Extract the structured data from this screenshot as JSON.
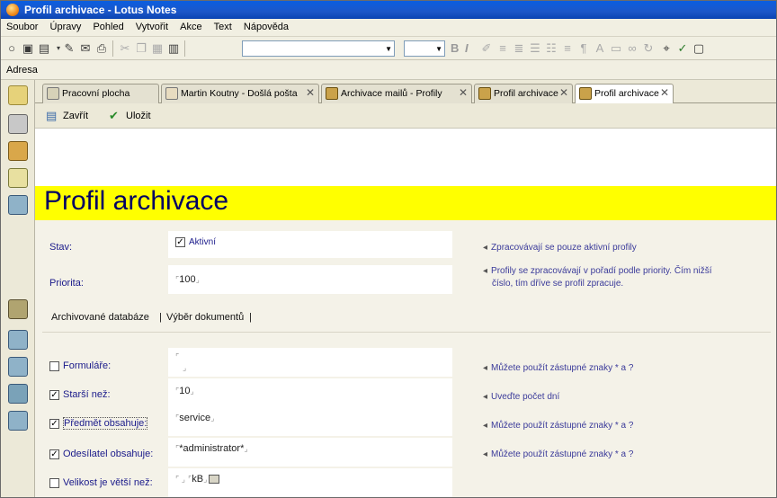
{
  "window": {
    "title": "Profil archivace - Lotus Notes"
  },
  "menu": [
    "Soubor",
    "Úpravy",
    "Pohled",
    "Vytvořit",
    "Akce",
    "Text",
    "Nápověda"
  ],
  "address": {
    "label": "Adresa"
  },
  "tabs": [
    {
      "label": "Pracovní plocha",
      "closable": false,
      "active": false
    },
    {
      "label": "Martin Koutny - Došlá pošta",
      "closable": true,
      "active": false
    },
    {
      "label": "Archivace mailů - Profily",
      "closable": true,
      "active": false
    },
    {
      "label": "Profil archivace",
      "closable": true,
      "active": false
    },
    {
      "label": "Profil archivace",
      "closable": true,
      "active": true
    }
  ],
  "actions": {
    "close_label": "Zavřít",
    "save_label": "Uložit"
  },
  "form": {
    "title": "Profil archivace",
    "stav": {
      "label": "Stav:",
      "checkbox_label": "Aktivní",
      "checked": true,
      "hint": "Zpracovávají se pouze aktivní profily"
    },
    "priorita": {
      "label": "Priorita:",
      "value": "100",
      "hint_line1": "Profily se zpracovávají v pořadí podle priority. Čím nižší",
      "hint_line2": "číslo, tím dříve se profil zpracuje."
    },
    "subtabs": [
      "Archivované databáze",
      "Výběr dokumentů"
    ],
    "rows": [
      {
        "label": "Formuláře:",
        "checked": false,
        "value": "",
        "hint": "Můžete použít zástupné znaky * a ?"
      },
      {
        "label": "Starší než:",
        "checked": true,
        "value": "10",
        "hint": "Uveďte počet dní"
      },
      {
        "label": "Předmět obsahuje:",
        "checked": true,
        "value": "service",
        "hint": "Můžete použít zástupné znaky * a ?"
      },
      {
        "label": "Odesílatel obsahuje:",
        "checked": true,
        "value": "*administrator*",
        "hint": "Můžete použít zástupné znaky * a ?"
      },
      {
        "label": "Velikost je větší než:",
        "checked": false,
        "value": "",
        "unit": "kB",
        "hint": ""
      }
    ]
  },
  "colors": {
    "titlebar": "#1c57c8",
    "banner": "#ffff00",
    "title_text": "#000064",
    "label_text": "#1a1a8a"
  }
}
